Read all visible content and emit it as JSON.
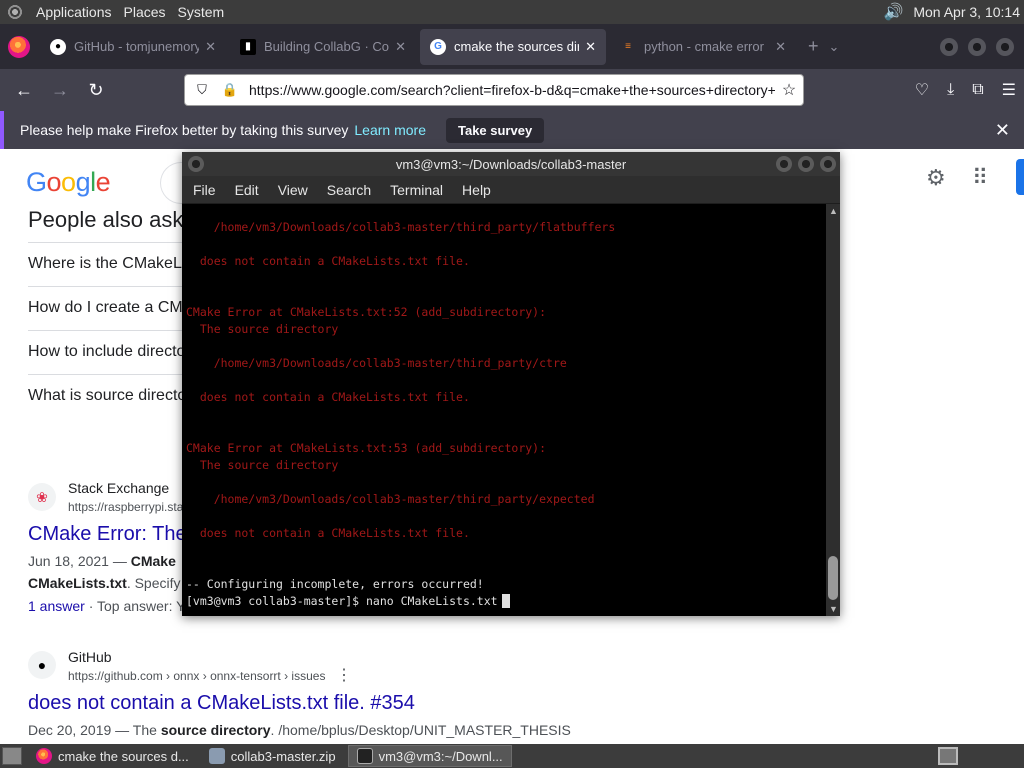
{
  "panel": {
    "applications": "Applications",
    "places": "Places",
    "system": "System",
    "clock": "Mon Apr  3, 10:14"
  },
  "browser": {
    "tabs": [
      {
        "title": "GitHub - tomjunemory/..."
      },
      {
        "title": "Building CollabG · Colla"
      },
      {
        "title": "cmake the sources dire"
      },
      {
        "title": "python - cmake error"
      }
    ],
    "url": "https://www.google.com/search?client=firefox-b-d&q=cmake+the+sources+directory+d",
    "notification": {
      "message": "Please help make Firefox better by taking this survey",
      "learn_more": "Learn more",
      "button": "Take survey"
    }
  },
  "google": {
    "logo": [
      "G",
      "o",
      "o",
      "g",
      "l",
      "e"
    ],
    "paa_title": "People also ask",
    "paa_items": [
      "Where is the CMakeL",
      "How do I create a CM",
      "How to include directo",
      "What is source directo"
    ],
    "result1": {
      "source": "Stack Exchange",
      "url": "https://raspberrypi.sta",
      "title": "CMake Error: The",
      "date": "Jun 18, 2021 — ",
      "snippet1_bold": "CMake",
      "snippet2_bold": "CMakeLists.txt",
      "snippet2_rest": ". Specify",
      "answers_link": "1 answer",
      "answers_rest": " · Top answer: Y"
    },
    "result2": {
      "source": "GitHub",
      "url": "https://github.com › onnx › onnx-tensorrt › issues",
      "title": "does not contain a CMakeLists.txt file. #354",
      "date": "Dec 20, 2019 — The ",
      "snippet_bold": "source directory",
      "snippet_rest": ". /home/bplus/Desktop/UNIT_MASTER_THESIS"
    }
  },
  "terminal": {
    "title": "vm3@vm3:~/Downloads/collab3-master",
    "menu": [
      "File",
      "Edit",
      "View",
      "Search",
      "Terminal",
      "Help"
    ],
    "lines": [
      {
        "text": "    /home/vm3/Downloads/collab3-master/third_party/flatbuffers",
        "color": "red"
      },
      {
        "text": "  does not contain a CMakeLists.txt file.",
        "color": "red"
      },
      {
        "text": "CMake Error at CMakeLists.txt:52 (add_subdirectory):",
        "color": "red"
      },
      {
        "text": "  The source directory",
        "color": "red"
      },
      {
        "text": "    /home/vm3/Downloads/collab3-master/third_party/ctre",
        "color": "red"
      },
      {
        "text": "  does not contain a CMakeLists.txt file.",
        "color": "red"
      },
      {
        "text": "CMake Error at CMakeLists.txt:53 (add_subdirectory):",
        "color": "red"
      },
      {
        "text": "  The source directory",
        "color": "red"
      },
      {
        "text": "    /home/vm3/Downloads/collab3-master/third_party/expected",
        "color": "red"
      },
      {
        "text": "  does not contain a CMakeLists.txt file.",
        "color": "red"
      },
      {
        "text": "-- Configuring incomplete, errors occurred!",
        "color": "white"
      },
      {
        "text": "[vm3@vm3 collab3-master]$ nano CMakeLists.txt",
        "color": "white"
      }
    ]
  },
  "taskbar": {
    "tasks": [
      {
        "label": "cmake the sources d..."
      },
      {
        "label": "collab3-master.zip"
      },
      {
        "label": "vm3@vm3:~/Downl..."
      }
    ]
  },
  "colors": {
    "terminal_error": "#a01818",
    "link": "#1a0dab",
    "firefox_chrome": "#2b2a33"
  }
}
